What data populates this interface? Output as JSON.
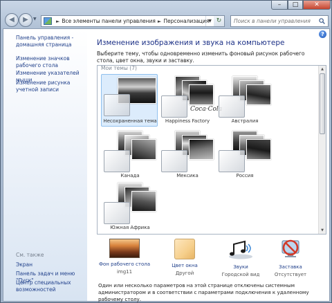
{
  "window": {
    "min_glyph": "–",
    "max_glyph": "□",
    "close_glyph": "✕"
  },
  "navigation": {
    "back_glyph": "◀",
    "forward_glyph": "▶",
    "dropdown_glyph": "▼"
  },
  "address_bar": {
    "separator": "►",
    "crumbs": [
      "Все элементы панели управления",
      "Персонализация"
    ],
    "dropdown_glyph": "▼",
    "refresh_glyph": "↻"
  },
  "search": {
    "placeholder": "Поиск в панели управления"
  },
  "sidebar": {
    "links": [
      "Панель управления - домашняя страница",
      "Изменение значков рабочего стола",
      "Изменение указателей мыши",
      "Изменение рисунка учетной записи"
    ],
    "see_also_title": "См. также",
    "see_also_links": [
      "Экран",
      "Панель задач и меню \"Пуск\"",
      "Центр специальных возможностей"
    ]
  },
  "main": {
    "help_glyph": "?",
    "title": "Изменение изображения и звука на компьютере",
    "description": "Выберите тему, чтобы одновременно изменить фоновый рисунок рабочего стола, цвет окна, звуки и заставку.",
    "group_label": "Мои темы (7)",
    "themes": [
      {
        "name": "Несохраненная тема",
        "selected": true
      },
      {
        "name": "Happiness Factory",
        "selected": false
      },
      {
        "name": "Австралия",
        "selected": false
      },
      {
        "name": "Канада",
        "selected": false
      },
      {
        "name": "Мексика",
        "selected": false
      },
      {
        "name": "Россия",
        "selected": false
      },
      {
        "name": "Южная Африка",
        "selected": false
      }
    ],
    "scroll_up_glyph": "▲",
    "scroll_down_glyph": "▼"
  },
  "bottom_bar": {
    "wallpaper": {
      "label": "Фон рабочего стола",
      "value": "img11"
    },
    "window_color": {
      "label": "Цвет окна",
      "value": "Другой"
    },
    "sounds": {
      "label": "Звуки",
      "value": "Городской вид"
    },
    "screensaver": {
      "label": "Заставка",
      "value": "Отсутствует"
    }
  },
  "notice": "Один или несколько параметров на этой странице отключены системным администратором и в соответствии с параметрами подключения к удаленному рабочему столу.",
  "colors": {
    "link": "#1f3f8a",
    "title": "#1e3287",
    "selection": "#dcecfc",
    "window_color_swatch": "#f6cf8c"
  },
  "icons": [
    "search-icon",
    "help-icon",
    "refresh-icon",
    "music-notes-icon",
    "no-screensaver-icon",
    "control-panel-icon"
  ]
}
